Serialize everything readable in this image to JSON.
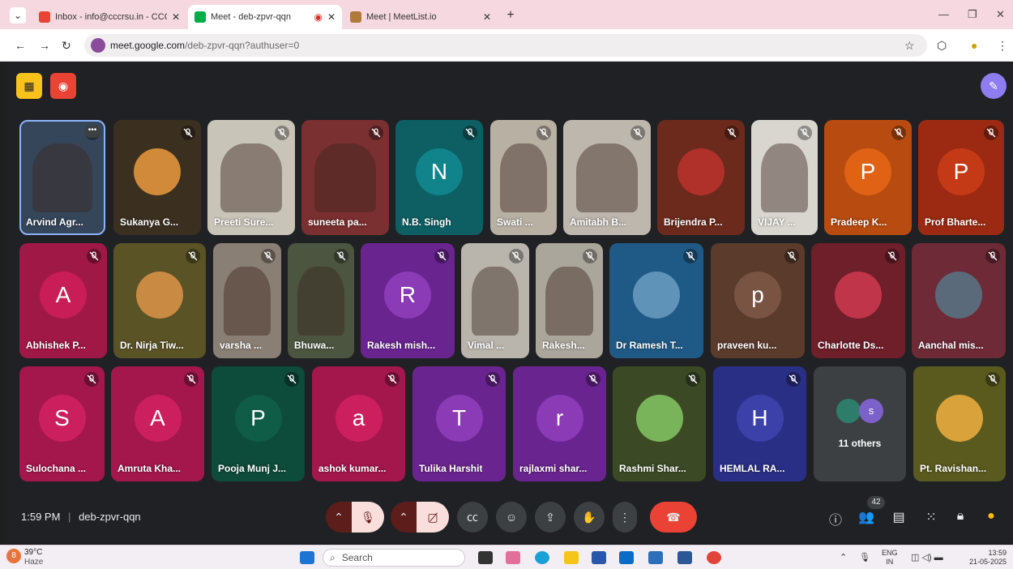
{
  "browser": {
    "tabs": [
      {
        "title": "Inbox - info@cccrsu.in - CCCRS",
        "color": "#ea4335"
      },
      {
        "title": "Meet - deb-zpvr-qqn",
        "color": "#00ac47",
        "active": true
      },
      {
        "title": "Meet | MeetList.io",
        "color": "#b07a3a"
      }
    ],
    "new_tab": "+",
    "url_host": "meet.google.com",
    "url_path": "/deb-zpvr-qqn?authuser=0"
  },
  "participants_row1": [
    {
      "name": "Arvind Agr...",
      "bg": "#35465b",
      "kind": "video"
    },
    {
      "name": "Sukanya G...",
      "bg": "#3b2f20",
      "kind": "photo",
      "photo": "#d08a3a"
    },
    {
      "name": "Preeti Sure...",
      "bg": "#c9c4b8",
      "kind": "video"
    },
    {
      "name": "suneeta pa...",
      "bg": "#7a2f30",
      "kind": "video"
    },
    {
      "name": "N.B. Singh",
      "bg": "#0d5f63",
      "kind": "avatar",
      "letter": "N",
      "circle": "#11838a"
    },
    {
      "name": "Swati ...",
      "bg": "#b9b0a4",
      "kind": "video"
    },
    {
      "name": "Amitabh B...",
      "bg": "#bdb7ae",
      "kind": "video"
    },
    {
      "name": "Brijendra P...",
      "bg": "#6b2a1c",
      "kind": "photo",
      "photo": "#b0302a"
    },
    {
      "name": "VIJAY ...",
      "bg": "#d9d6cf",
      "kind": "video"
    },
    {
      "name": "Pradeep K...",
      "bg": "#b84b0f",
      "kind": "avatar",
      "letter": "P",
      "circle": "#e06315"
    },
    {
      "name": "Prof Bharte...",
      "bg": "#9c2a12",
      "kind": "avatar",
      "letter": "P",
      "circle": "#c53a16"
    }
  ],
  "participants_row2": [
    {
      "name": "Abhishek P...",
      "bg": "#a01846",
      "kind": "avatar",
      "letter": "A",
      "circle": "#c81d57"
    },
    {
      "name": "Dr. Nirja Tiw...",
      "bg": "#5a5326",
      "kind": "photo",
      "photo": "#c98a44"
    },
    {
      "name": "varsha ...",
      "bg": "#8a7f74",
      "kind": "video"
    },
    {
      "name": "Bhuwa...",
      "bg": "#4c5540",
      "kind": "video"
    },
    {
      "name": "Rakesh mish...",
      "bg": "#6a2490",
      "kind": "avatar",
      "letter": "R",
      "circle": "#8a3bb5"
    },
    {
      "name": "Vimal ...",
      "bg": "#b9b5ac",
      "kind": "video"
    },
    {
      "name": "Rakesh...",
      "bg": "#aba69c",
      "kind": "video"
    },
    {
      "name": "Dr Ramesh T...",
      "bg": "#1f5a86",
      "kind": "photo",
      "photo": "#5f93b8"
    },
    {
      "name": "praveen ku...",
      "bg": "#5a3b2c",
      "kind": "avatar",
      "letter": "p",
      "circle": "#7a5443"
    },
    {
      "name": "Charlotte Ds...",
      "bg": "#6e1f2a",
      "kind": "photo",
      "photo": "#c0354a"
    },
    {
      "name": "Aanchal mis...",
      "bg": "#6e2a37",
      "kind": "photo",
      "photo": "#5a6a7a"
    }
  ],
  "participants_row3": [
    {
      "name": "Sulochana ...",
      "bg": "#a3174d",
      "kind": "avatar",
      "letter": "S",
      "circle": "#cc1f5e"
    },
    {
      "name": "Amruta Kha...",
      "bg": "#a3174d",
      "kind": "avatar",
      "letter": "A",
      "circle": "#cc1f5e"
    },
    {
      "name": "Pooja Munj J...",
      "bg": "#0d4b3a",
      "kind": "avatar",
      "letter": "P",
      "circle": "#0f5c47"
    },
    {
      "name": "ashok kumar...",
      "bg": "#a3174d",
      "kind": "avatar",
      "letter": "a",
      "circle": "#cc1f5e"
    },
    {
      "name": "Tulika Harshit",
      "bg": "#6a2490",
      "kind": "avatar",
      "letter": "T",
      "circle": "#8a3bb5"
    },
    {
      "name": "rajlaxmi shar...",
      "bg": "#6a2490",
      "kind": "avatar",
      "letter": "r",
      "circle": "#8a3bb5"
    },
    {
      "name": "Rashmi Shar...",
      "bg": "#3b4a25",
      "kind": "photo",
      "photo": "#7ab45a"
    },
    {
      "name": "HEMLAL RA...",
      "bg": "#2a2f86",
      "kind": "avatar",
      "letter": "H",
      "circle": "#3b41a8"
    },
    {
      "name": "11 others",
      "bg": "#3c4043",
      "kind": "others",
      "letter": "s"
    },
    {
      "name": "Pt. Ravishan...",
      "bg": "#5a5a1f",
      "kind": "photo",
      "photo": "#d9a23a"
    }
  ],
  "meeting": {
    "time": "1:59 PM",
    "separator": "|",
    "code": "deb-zpvr-qqn",
    "people_count": "42"
  },
  "taskbar": {
    "temperature": "39°C",
    "weather": "Haze",
    "weather_badge": "8",
    "search_placeholder": "Search",
    "lang_top": "ENG",
    "lang_bottom": "IN",
    "time": "13:59",
    "date": "21-05-2025"
  },
  "colors": {
    "meet_bg": "#202124",
    "end_call": "#ea4335",
    "mic_off": "#f9dedc"
  }
}
